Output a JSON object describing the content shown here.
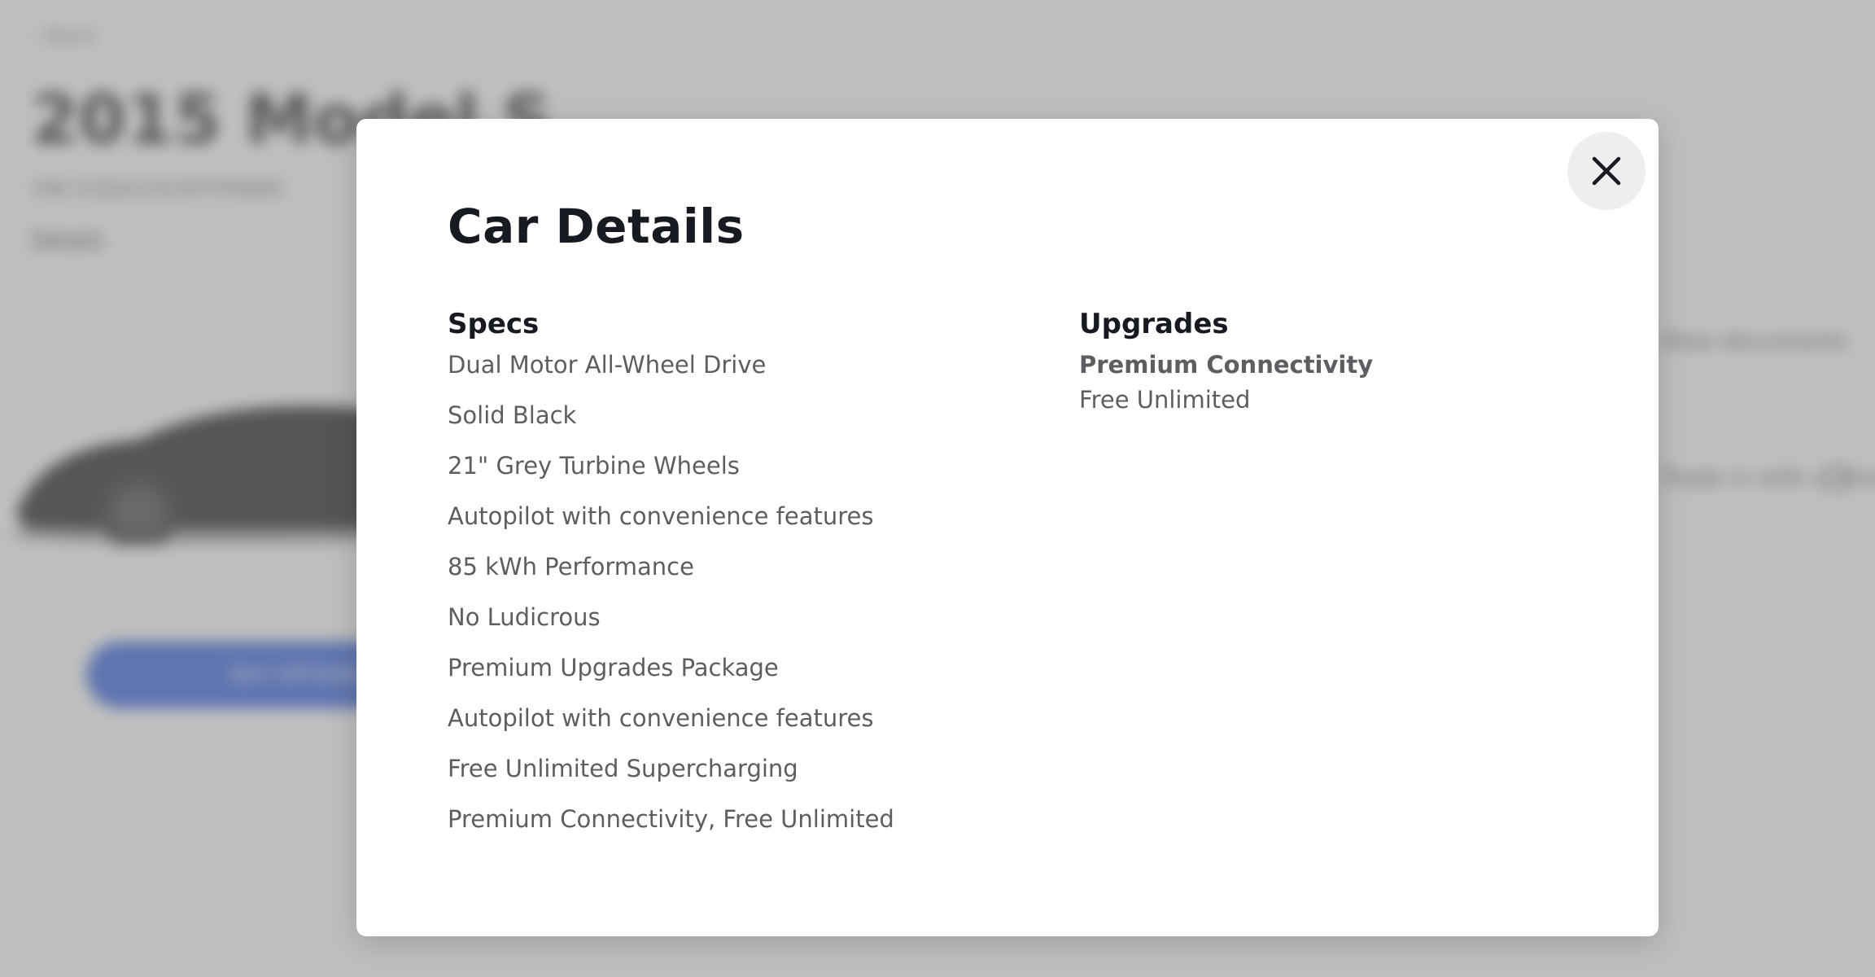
{
  "background": {
    "back_label": "‹ Back",
    "title": "2015 Model S",
    "vin": "VIN 5YJSA1H2XFFP0000",
    "details_link": "Details",
    "primary_button": "BUY OPTIONS",
    "side_link": "View documents",
    "side_question": "Trade in with a third party?",
    "accent_color": "#3e6ae1"
  },
  "modal": {
    "title": "Car Details",
    "close_icon": "close-icon",
    "specs": {
      "heading": "Specs",
      "items": [
        "Dual Motor All-Wheel Drive",
        "Solid Black",
        "21\" Grey Turbine Wheels",
        "Autopilot with convenience features",
        "85 kWh Performance",
        "No Ludicrous",
        "Premium Upgrades Package",
        "Autopilot with convenience features",
        "Free Unlimited Supercharging",
        "Premium Connectivity, Free Unlimited"
      ]
    },
    "upgrades": {
      "heading": "Upgrades",
      "items": [
        {
          "name": "Premium Connectivity",
          "value": "Free Unlimited"
        }
      ]
    }
  }
}
